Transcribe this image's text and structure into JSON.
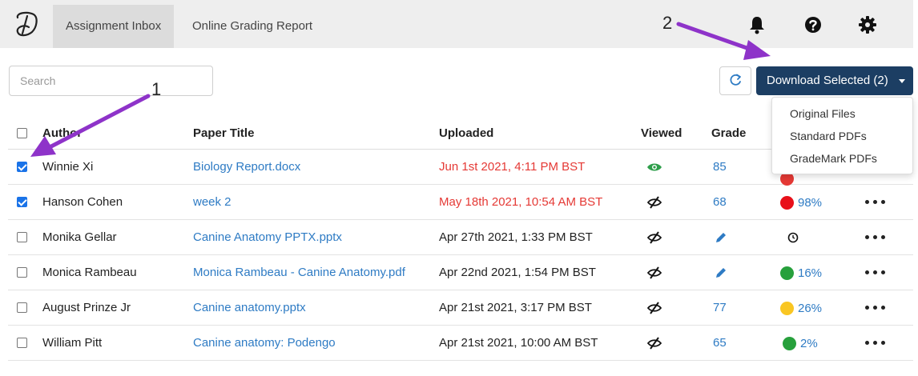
{
  "nav": {
    "tabs": [
      {
        "label": "Assignment Inbox",
        "active": true
      },
      {
        "label": "Online Grading Report",
        "active": false
      }
    ],
    "icons": [
      "bell-icon",
      "help-icon",
      "gear-icon"
    ]
  },
  "toolbar": {
    "search_placeholder": "Search",
    "download_label": "Download Selected (2)",
    "download_menu": [
      "Original Files",
      "Standard PDFs",
      "GradeMark PDFs"
    ]
  },
  "table": {
    "headers": {
      "author": "Author",
      "title": "Paper Title",
      "uploaded": "Uploaded",
      "viewed": "Viewed",
      "grade": "Grade"
    },
    "rows": [
      {
        "checked": true,
        "author": "Winnie Xi",
        "title": "Biology Report.docx",
        "uploaded": "Jun 1st 2021, 4:11 PM BST",
        "late": true,
        "viewed": true,
        "grade": "85",
        "grade_icon": "",
        "similarity": "",
        "similarity_color": "#e53935"
      },
      {
        "checked": true,
        "author": "Hanson Cohen",
        "title": "week 2",
        "uploaded": "May 18th 2021, 10:54 AM BST",
        "late": true,
        "viewed": false,
        "grade": "68",
        "grade_icon": "",
        "similarity": "98%",
        "similarity_color": "#e8101a"
      },
      {
        "checked": false,
        "author": "Monika Gellar",
        "title": "Canine Anatomy PPTX.pptx",
        "uploaded": "Apr 27th 2021, 1:33 PM BST",
        "late": false,
        "viewed": false,
        "grade": "",
        "grade_icon": "pencil-icon",
        "similarity": "",
        "similarity_color": "",
        "similarity_icon": "clock-icon"
      },
      {
        "checked": false,
        "author": "Monica Rambeau",
        "title": "Monica Rambeau - Canine Anatomy.pdf",
        "uploaded": "Apr 22nd 2021, 1:54 PM BST",
        "late": false,
        "viewed": false,
        "grade": "",
        "grade_icon": "pencil-icon",
        "similarity": "16%",
        "similarity_color": "#27a03c"
      },
      {
        "checked": false,
        "author": "August Prinze Jr",
        "title": "Canine anatomy.pptx",
        "uploaded": "Apr 21st 2021, 3:17 PM BST",
        "late": false,
        "viewed": false,
        "grade": "77",
        "grade_icon": "",
        "similarity": "26%",
        "similarity_color": "#f9c623"
      },
      {
        "checked": false,
        "author": "William Pitt",
        "title": "Canine anatomy: Podengo",
        "uploaded": "Apr 21st 2021, 10:00 AM BST",
        "late": false,
        "viewed": false,
        "grade": "65",
        "grade_icon": "",
        "similarity": "2%",
        "similarity_color": "#27a03c"
      }
    ]
  },
  "annotations": {
    "label_1": "1",
    "label_2": "2",
    "arrow_color": "#8e33c9"
  },
  "colors": {
    "accent": "#1c3e63",
    "link": "#2e7bc4",
    "late": "#e53935",
    "viewed": "#2e9e4a"
  }
}
